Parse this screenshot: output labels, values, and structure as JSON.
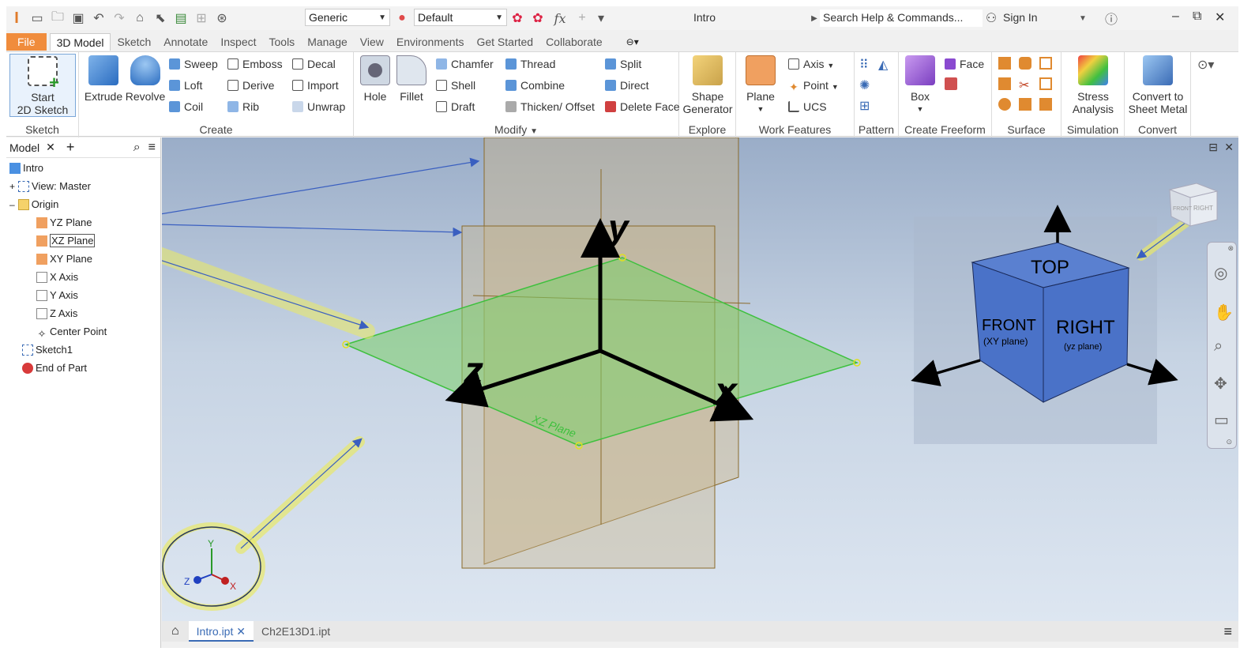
{
  "titlebar": {
    "material": "Generic",
    "appearance": "Default",
    "doc_title": "Intro",
    "search_placeholder": "Search Help & Commands...",
    "signin": "Sign In",
    "fx": "fx"
  },
  "tabs": [
    "File",
    "3D Model",
    "Sketch",
    "Annotate",
    "Inspect",
    "Tools",
    "Manage",
    "View",
    "Environments",
    "Get Started",
    "Collaborate"
  ],
  "ribbon": {
    "sketch": {
      "button": "Start\n2D Sketch",
      "line1": "Start",
      "line2": "2D Sketch",
      "label": "Sketch"
    },
    "create": {
      "extrude": "Extrude",
      "revolve": "Revolve",
      "sweep": "Sweep",
      "loft": "Loft",
      "coil": "Coil",
      "emboss": "Emboss",
      "derive": "Derive",
      "rib": "Rib",
      "decal": "Decal",
      "import": "Import",
      "unwrap": "Unwrap",
      "label": "Create"
    },
    "modify": {
      "hole": "Hole",
      "fillet": "Fillet",
      "chamfer": "Chamfer",
      "shell": "Shell",
      "draft": "Draft",
      "thread": "Thread",
      "combine": "Combine",
      "thicken": "Thicken/ Offset",
      "split": "Split",
      "direct": "Direct",
      "delete_face": "Delete Face",
      "label": "Modify"
    },
    "explore": {
      "shape_gen_1": "Shape",
      "shape_gen_2": "Generator",
      "label": "Explore"
    },
    "work": {
      "plane": "Plane",
      "axis": "Axis",
      "point": "Point",
      "ucs": "UCS",
      "label": "Work Features"
    },
    "pattern": {
      "label": "Pattern"
    },
    "freeform": {
      "box": "Box",
      "face": "Face",
      "label": "Create Freeform"
    },
    "surface": {
      "label": "Surface"
    },
    "simulation": {
      "l1": "Stress",
      "l2": "Analysis",
      "label": "Simulation"
    },
    "convert": {
      "l1": "Convert to",
      "l2": "Sheet Metal",
      "label": "Convert"
    }
  },
  "browser": {
    "tab": "Model",
    "root": "Intro",
    "nodes": [
      "View: Master",
      "Origin",
      "YZ Plane",
      "XZ Plane",
      "XY Plane",
      "X Axis",
      "Y Axis",
      "Z Axis",
      "Center Point",
      "Sketch1",
      "End of Part"
    ]
  },
  "viewport": {
    "axis_labels": {
      "y": "y",
      "z": "z",
      "x": "x"
    },
    "plane_label": "XZ Plane",
    "cube": {
      "top": "TOP",
      "front": "FRONT",
      "front_sub": "(XY plane)",
      "right": "RIGHT",
      "right_sub": "(yz plane)"
    },
    "viewcube": {
      "front": "FRONT",
      "right": "RIGHT"
    },
    "triad": {
      "x": "X",
      "y": "Y",
      "z": "Z"
    }
  },
  "doctabs": [
    "Intro.ipt",
    "Ch2E13D1.ipt"
  ],
  "colors": {
    "accent": "#f08c3c",
    "cube": "#4a72c8",
    "plane_green": "#7ccf6a",
    "plane_tan": "#c9b48a",
    "highlight": "#e8e86a"
  }
}
